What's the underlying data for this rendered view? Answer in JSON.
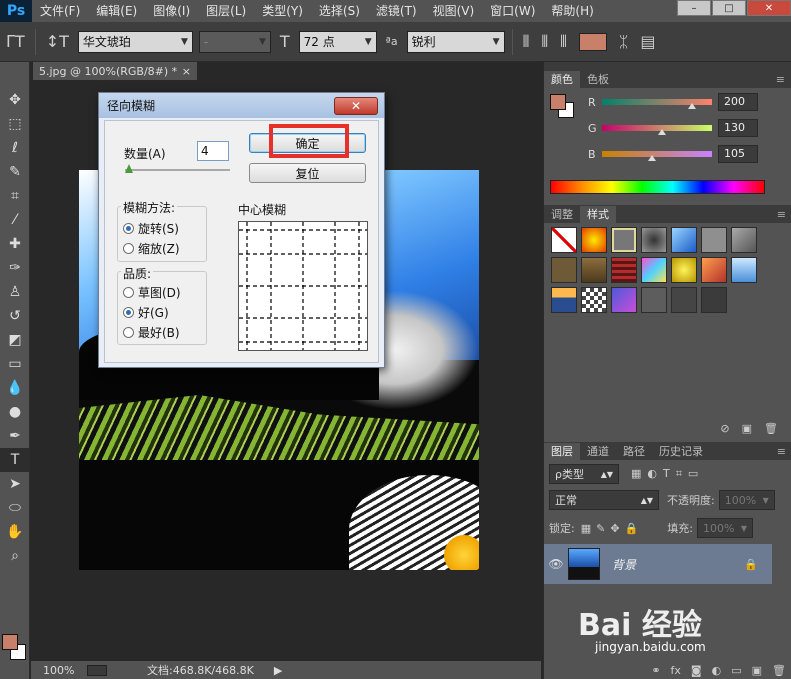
{
  "app": {
    "logo": "Ps"
  },
  "menu": [
    "文件(F)",
    "编辑(E)",
    "图像(I)",
    "图层(L)",
    "类型(Y)",
    "选择(S)",
    "滤镜(T)",
    "视图(V)",
    "窗口(W)",
    "帮助(H)"
  ],
  "options": {
    "font_family": "华文琥珀",
    "font_style": "-",
    "font_size": "72 点",
    "aa_label": "ªa",
    "antialias": "锐利",
    "text_color": "#c8806a"
  },
  "document": {
    "tab_label": "5.jpg @ 100%(RGB/8#) *",
    "zoom": "100%",
    "doc_info": "文档:468.8K/468.8K"
  },
  "dialog": {
    "title": "径向模糊",
    "amount_label": "数量(A)",
    "amount_value": "4",
    "ok_label": "确定",
    "reset_label": "复位",
    "blur_method_title": "模糊方法:",
    "spin_label": "旋转(S)",
    "zoom_label": "缩放(Z)",
    "quality_title": "品质:",
    "draft_label": "草图(D)",
    "good_label": "好(G)",
    "best_label": "最好(B)",
    "center_label": "中心模糊",
    "selected_method": "spin",
    "selected_quality": "good"
  },
  "color_panel": {
    "tabs": [
      "颜色",
      "色板"
    ],
    "r_label": "R",
    "g_label": "G",
    "b_label": "B",
    "r": "200",
    "g": "130",
    "b": "105",
    "foreground": "#c8806a"
  },
  "styles_panel": {
    "tabs": [
      "调整",
      "样式"
    ]
  },
  "layers_panel": {
    "tabs": [
      "图层",
      "通道",
      "路径",
      "历史记录"
    ],
    "kind_label": "ρ类型",
    "blend_mode": "正常",
    "opacity_label": "不透明度:",
    "opacity": "100%",
    "lock_label": "锁定:",
    "fill_label": "填充:",
    "fill": "100%",
    "layer_name": "背景"
  },
  "watermark": {
    "text": "Bai 经验",
    "url": "jingyan.baidu.com"
  }
}
